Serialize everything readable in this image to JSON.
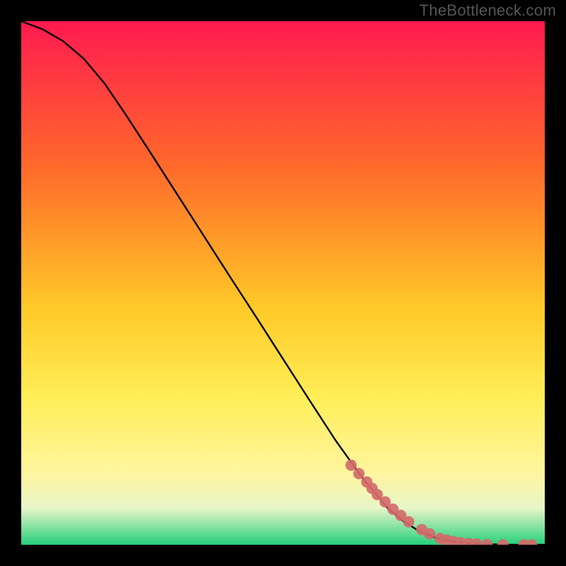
{
  "watermark": "TheBottleneck.com",
  "colors": {
    "bg_top": "#ff1a50",
    "bg_mid1": "#ff6a2a",
    "bg_mid2": "#ffca28",
    "bg_mid3": "#ffee58",
    "bg_mid4": "#fff59d",
    "bg_mid5": "#e8f5c8",
    "bg_bot": "#25d07c",
    "curve": "#000000",
    "marker": "#d46a6a"
  },
  "chart_data": {
    "type": "line",
    "title": "",
    "xlabel": "",
    "ylabel": "",
    "xlim": [
      0,
      100
    ],
    "ylim": [
      0,
      100
    ],
    "series": [
      {
        "name": "curve",
        "x": [
          0,
          4,
          8,
          12,
          16,
          20,
          25,
          30,
          35,
          40,
          45,
          50,
          55,
          60,
          65,
          70,
          73,
          76,
          79,
          82,
          85,
          88,
          91,
          94,
          97,
          100
        ],
        "y": [
          100,
          98.5,
          96.2,
          92.8,
          88.0,
          82.1,
          74.4,
          66.6,
          58.8,
          51.0,
          43.3,
          35.5,
          27.7,
          20.0,
          13.0,
          7.0,
          4.5,
          2.6,
          1.4,
          0.7,
          0.3,
          0.12,
          0.05,
          0.0,
          0.0,
          0.0
        ]
      }
    ],
    "markers": {
      "name": "highlight",
      "x": [
        63,
        64.5,
        66,
        67,
        68,
        69.5,
        71,
        72.5,
        74,
        76.5,
        78,
        80,
        81.2,
        82.5,
        84,
        85.5,
        87,
        89,
        92,
        96,
        97.5
      ],
      "y": [
        15.2,
        13.6,
        12.0,
        10.8,
        9.6,
        8.2,
        6.8,
        5.6,
        4.4,
        2.9,
        2.1,
        1.2,
        0.9,
        0.65,
        0.4,
        0.25,
        0.15,
        0.05,
        0.0,
        0.0,
        0.0
      ]
    }
  }
}
